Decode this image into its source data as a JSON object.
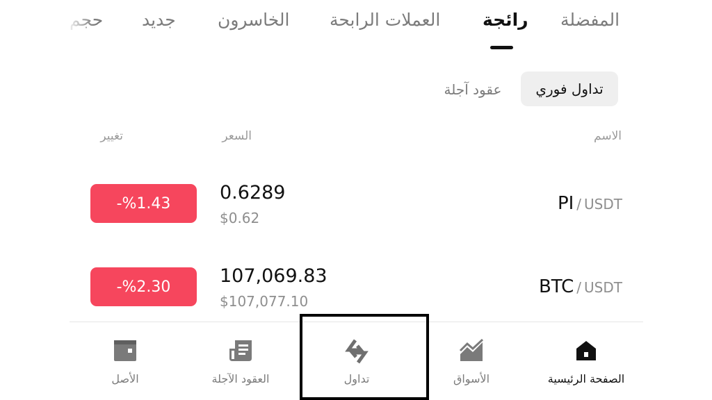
{
  "tabs": [
    {
      "label": "المفضلة",
      "active": false
    },
    {
      "label": "رائجة",
      "active": true
    },
    {
      "label": "العملات الرابحة",
      "active": false
    },
    {
      "label": "الخاسرون",
      "active": false
    },
    {
      "label": "جديد",
      "active": false
    },
    {
      "label": "حجم",
      "active": false
    }
  ],
  "subtabs": {
    "spot": "تداول فوري",
    "futures": "عقود آجلة"
  },
  "columns": {
    "name": "الاسم",
    "price": "السعر",
    "change": "تغيير"
  },
  "rows": [
    {
      "base": "PI",
      "separator": "/",
      "quote": "USDT",
      "price": "0.6289",
      "price_usd": "$0.62",
      "change": "-%1.43"
    },
    {
      "base": "BTC",
      "separator": "/",
      "quote": "USDT",
      "price": "107,069.83",
      "price_usd": "$107,077.10",
      "change": "-%2.30"
    }
  ],
  "bottom_nav": [
    {
      "label": "الصفحة الرئيسية",
      "icon": "home-icon",
      "active": true
    },
    {
      "label": "الأسواق",
      "icon": "markets-chart-icon",
      "active": false
    },
    {
      "label": "تداول",
      "icon": "trade-swap-icon",
      "active": false
    },
    {
      "label": "العقود الآجلة",
      "icon": "futures-document-icon",
      "active": false
    },
    {
      "label": "الأصل",
      "icon": "wallet-icon",
      "active": false
    }
  ],
  "colors": {
    "negative_badge": "#f6465d",
    "active_text": "#111111",
    "inactive_text": "#7b7b7b",
    "icon_gray": "#6f6f6f"
  }
}
